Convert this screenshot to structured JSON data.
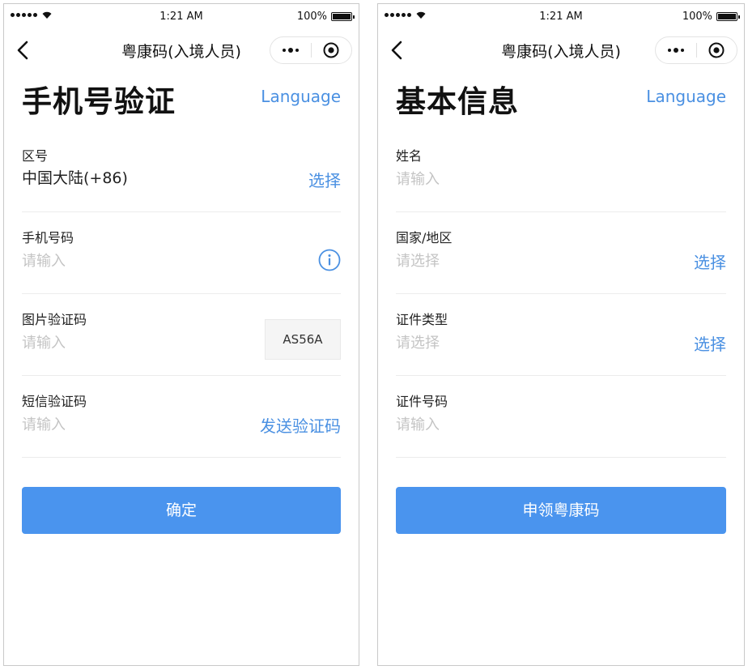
{
  "left": {
    "status": {
      "time": "1:21 AM",
      "battery": "100%"
    },
    "nav": {
      "title": "粤康码(入境人员)"
    },
    "page": {
      "title": "手机号验证",
      "language": "Language"
    },
    "fields": {
      "area": {
        "label": "区号",
        "value": "中国大陆(+86)",
        "action": "选择"
      },
      "phone": {
        "label": "手机号码",
        "placeholder": "请输入"
      },
      "image_code": {
        "label": "图片验证码",
        "placeholder": "请输入",
        "captcha": "AS56A"
      },
      "sms_code": {
        "label": "短信验证码",
        "placeholder": "请输入",
        "action": "发送验证码"
      }
    },
    "submit": "确定"
  },
  "right": {
    "status": {
      "time": "1:21 AM",
      "battery": "100%"
    },
    "nav": {
      "title": "粤康码(入境人员)"
    },
    "page": {
      "title": "基本信息",
      "language": "Language"
    },
    "fields": {
      "name": {
        "label": "姓名",
        "placeholder": "请输入"
      },
      "country": {
        "label": "国家/地区",
        "placeholder": "请选择",
        "action": "选择"
      },
      "id_type": {
        "label": "证件类型",
        "placeholder": "请选择",
        "action": "选择"
      },
      "id_number": {
        "label": "证件号码",
        "placeholder": "请输入"
      }
    },
    "submit": "申领粤康码"
  },
  "colors": {
    "accent": "#4a90e2",
    "button": "#4a94ee",
    "placeholder": "#c4c4c4",
    "divider": "#ececec"
  },
  "icons": [
    "signal-icon",
    "wifi-icon",
    "battery-icon",
    "back-icon",
    "more-icon",
    "close-target-icon",
    "info-icon"
  ]
}
